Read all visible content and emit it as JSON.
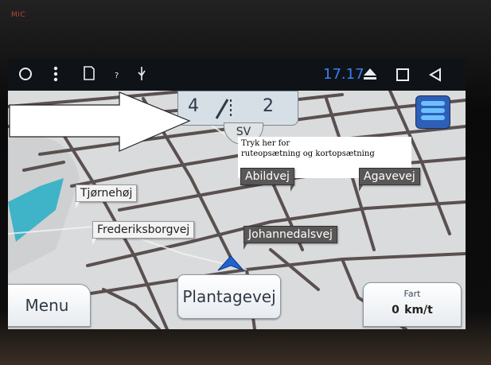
{
  "device": {
    "mic_label": "MIC"
  },
  "statusbar": {
    "clock": "17.17",
    "icons": [
      "circle-icon",
      "menu-dots-icon",
      "sd-card-icon",
      "question-icon",
      "usb-icon",
      "eject-icon",
      "square-icon",
      "back-icon"
    ]
  },
  "map": {
    "streets": {
      "tjornehoj": "Tjørnehøj",
      "abildvej": "Abildvej",
      "agavevej": "Agavevej",
      "frederiksborgvej": "Frederiksborgvej",
      "johannedalsvej": "Johannedalsvej"
    },
    "compass": "SV",
    "lane_left": "4",
    "lane_right": "2"
  },
  "bottom": {
    "menu_label": "Menu",
    "current_street": "Plantagevej",
    "speed_label": "Fart",
    "speed_value": "0",
    "speed_unit": "km/t"
  },
  "annotation": {
    "line1": "Tryk her for",
    "line2": "rutеopsætning og kortopsætning"
  },
  "colors": {
    "accent_blue": "#3d7ef0",
    "map_bg": "#d9dadb",
    "road": "#5a5050"
  }
}
